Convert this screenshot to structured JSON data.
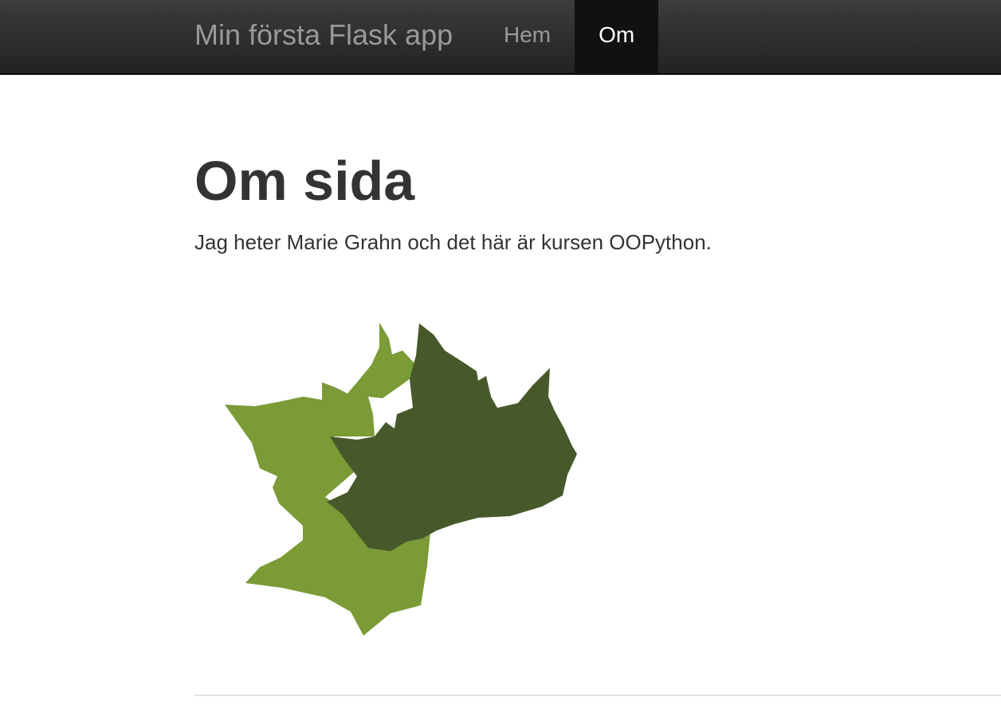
{
  "navbar": {
    "brand": "Min första Flask app",
    "items": [
      {
        "label": "Hem",
        "active": false
      },
      {
        "label": "Om",
        "active": true
      }
    ]
  },
  "main": {
    "heading": "Om sida",
    "intro": "Jag heter Marie Grahn och det här är kursen OOPython.",
    "image": {
      "name": "maple-leaves-icon",
      "colors": {
        "light_leaf": "#7a9b36",
        "dark_leaf": "#47592a"
      }
    }
  }
}
